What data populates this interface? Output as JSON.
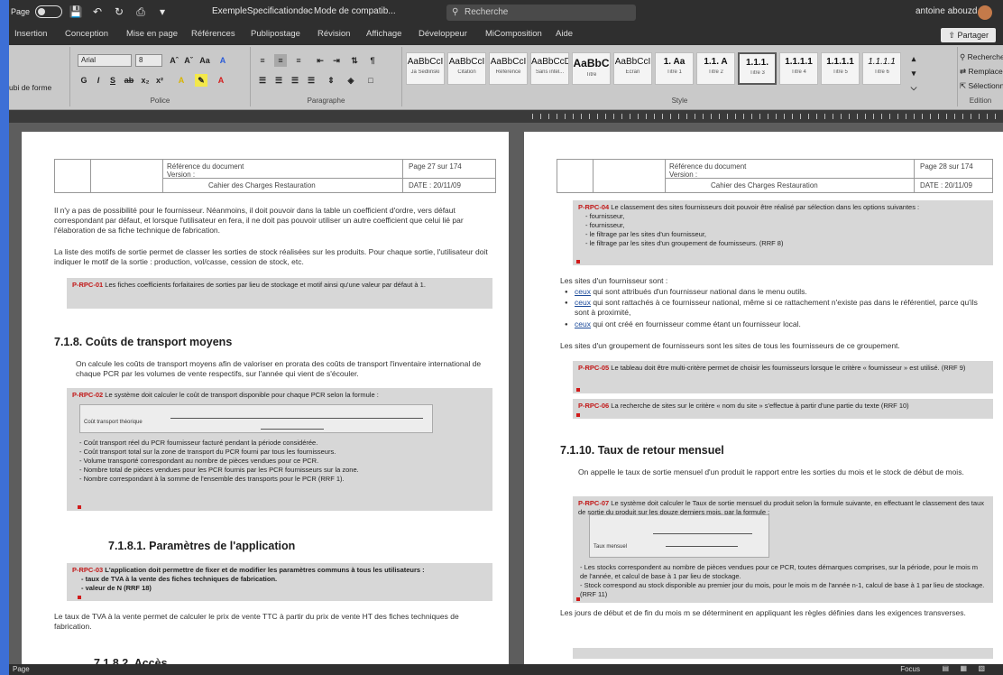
{
  "title_bar": {
    "left_label": "Page",
    "doc_title": "ExempleSpecificationdoc",
    "separator": "-",
    "save_state": "Mode de compatib...",
    "search_placeholder": "Recherche",
    "user_name": "antoine abouzd"
  },
  "tabs": [
    "Insertion",
    "Conception",
    "Mise en page",
    "Références",
    "Publipostage",
    "Révision",
    "Affichage",
    "Développeur",
    "MiComposition",
    "Aide"
  ],
  "share_label": "Partager",
  "ribbon": {
    "font_name": "Arial",
    "font_size": "8",
    "left_cut_label": "ubi de forme",
    "group_labels": {
      "police": "Police",
      "paragraphe": "Paragraphe",
      "styles": "Style",
      "edition": "Edition"
    },
    "editing": [
      "Rechercher",
      "Remplacer",
      "Sélectionner"
    ],
    "styles": [
      {
        "preview": "AaBbCcI",
        "name": "Ja Sedlinski"
      },
      {
        "preview": "AaBbCcI",
        "name": "Citation"
      },
      {
        "preview": "AaBbCcI",
        "name": "Référence"
      },
      {
        "preview": "AaBbCcD",
        "name": "Sans intel..."
      },
      {
        "preview": "AaBbC",
        "name": "Titre"
      },
      {
        "preview": "AaBbCcI",
        "name": "Ecran"
      },
      {
        "preview": "1.  Aa",
        "name": "Titre 1"
      },
      {
        "preview": "1.1.  A",
        "name": "Titre 2"
      },
      {
        "preview": "1.1.1.",
        "name": "Titre 3"
      },
      {
        "preview": "1.1.1.1",
        "name": "Titre 4"
      },
      {
        "preview": "1.1.1.1",
        "name": "Titre 5"
      },
      {
        "preview": "1.1.1.1",
        "name": "Titre 6"
      }
    ]
  },
  "page_left": {
    "header": {
      "ref": "Référence du document",
      "version": "Version :",
      "cahier": "Cahier des Charges Restauration",
      "page": "Page 27 sur 174",
      "date": "DATE : 20/11/09"
    },
    "para1": "Il n'y a pas de possibilité pour le fournisseur. Néanmoins, il doit pouvoir dans la table un coefficient d'ordre, vers défaut correspondant par défaut, et lorsque l'utilisateur en fera, il ne doit pas pouvoir utiliser un autre coefficient que celui lié par l'élaboration de sa fiche technique de fabrication.",
    "para2": "La liste des motifs de sortie permet de classer les sorties de stock réalisées sur les produits. Pour chaque sortie, l'utilisateur doit indiquer le motif de la sortie : production, vol/casse, cession de stock, etc.",
    "req1": "Les fiches coefficients forfaitaires de sorties par lieu de stockage et motif ainsi qu'une valeur par défaut à 1.",
    "req1_id": "P-RPC-01",
    "heading1": "7.1.8. Coûts de transport moyens",
    "para3": "On calcule les coûts de transport moyens afin de valoriser en prorata des coûts de transport l'inventaire international de chaque PCR par les volumes de vente respectifs, sur l'année qui vient de s'écouler.",
    "req2_id": "P-RPC-02",
    "req2": "Le système doit calculer le coût de transport disponible pour chaque PCR selon la formule :",
    "formula_l": "Coût transport théorique",
    "req2_lines": [
      "- Coût transport réel du PCR fournisseur facturé pendant la période considérée.",
      "- Coût transport total sur la zone de transport du PCR fourni par tous les fournisseurs.",
      "- Volume transporté correspondant au nombre de pièces vendues pour ce PCR.",
      "- Nombre total de pièces vendues pour les PCR fournis par les PCR fournisseurs sur la zone.",
      "- Nombre correspondant à la somme de l'ensemble des transports pour le PCR (RRF 1)."
    ],
    "heading2": "7.1.8.1. Paramètres de l'application",
    "req3_id": "P-RPC-03",
    "req3": "L'application doit permettre de fixer et de modifier les paramètres communs à tous les utilisateurs :",
    "req3_lines": [
      "- taux de TVA à la vente des fiches techniques de fabrication.",
      "- valeur de N (RRF 18)"
    ],
    "para4": "Le taux de TVA à la vente permet de calculer le prix de vente TTC à partir du prix de vente HT des fiches techniques de fabrication.",
    "tail_heading": "7.1.8.2. Accès"
  },
  "page_right": {
    "header": {
      "ref": "Référence du document",
      "version": "Version :",
      "cahier": "Cahier des Charges Restauration",
      "page": "Page 28 sur 174",
      "date": "DATE : 20/11/09"
    },
    "req1_id": "P-RPC-04",
    "req1": "Le classement des sites fournisseurs doit pouvoir être réalisé par sélection dans les options suivantes :",
    "req1_lines": [
      "- fournisseur,",
      "- fournisseur,",
      "- le filtrage par les sites d'un fournisseur,",
      "- le filtrage par les sites d'un groupement de fournisseurs. (RRF 8)"
    ],
    "para1": "Les sites d'un fournisseur sont :",
    "bullets": [
      {
        "link": "ceux",
        "text": "qui sont attribués d'un fournisseur national dans le menu outils."
      },
      {
        "link": "ceux",
        "text": "qui sont rattachés à ce fournisseur national, même si ce rattachement n'existe pas dans le référentiel, parce qu'ils sont à proximité,"
      },
      {
        "link": "ceux",
        "text": "qui ont créé en fournisseur comme étant un fournisseur local."
      }
    ],
    "para2": "Les sites d'un groupement de fournisseurs sont les sites de tous les fournisseurs de ce groupement.",
    "req2_id": "P-RPC-05",
    "req2": "Le tableau doit être multi-critère permet de choisir les fournisseurs lorsque le critère « fournisseur » est utilisé. (RRF 9)",
    "req3_id": "P-RPC-06",
    "req3": "La recherche de sites sur le critère « nom du site » s'effectue à partir d'une partie du texte (RRF 10)",
    "heading1": "7.1.10. Taux de retour mensuel",
    "para3": "On appelle le taux de sortie mensuel d'un produit le rapport entre les sorties du mois et le stock de début de mois.",
    "req4_id": "P-RPC-07",
    "req4": "Le système doit calculer le Taux de sortie mensuel du produit selon la formule suivante, en effectuant le classement des taux de sortie du produit sur les douze derniers mois, par la formule :",
    "formula_l": "Taux mensuel",
    "req4_lines": [
      "- Les stocks correspondent au nombre de pièces vendues pour ce PCR, toutes démarques comprises, sur la période, pour le mois m de l'année, et calcul de base à 1 par lieu de stockage.",
      "- Stock correspond au stock disponible au premier jour du mois, pour le mois m de l'année n-1, calcul de base à 1 par lieu de stockage. (RRF 11)"
    ],
    "para4": "Les jours de début et de fin du mois m se déterminent en appliquant les règles définies dans les exigences transverses."
  },
  "status": {
    "left": "Page",
    "zoom": "Focus"
  }
}
